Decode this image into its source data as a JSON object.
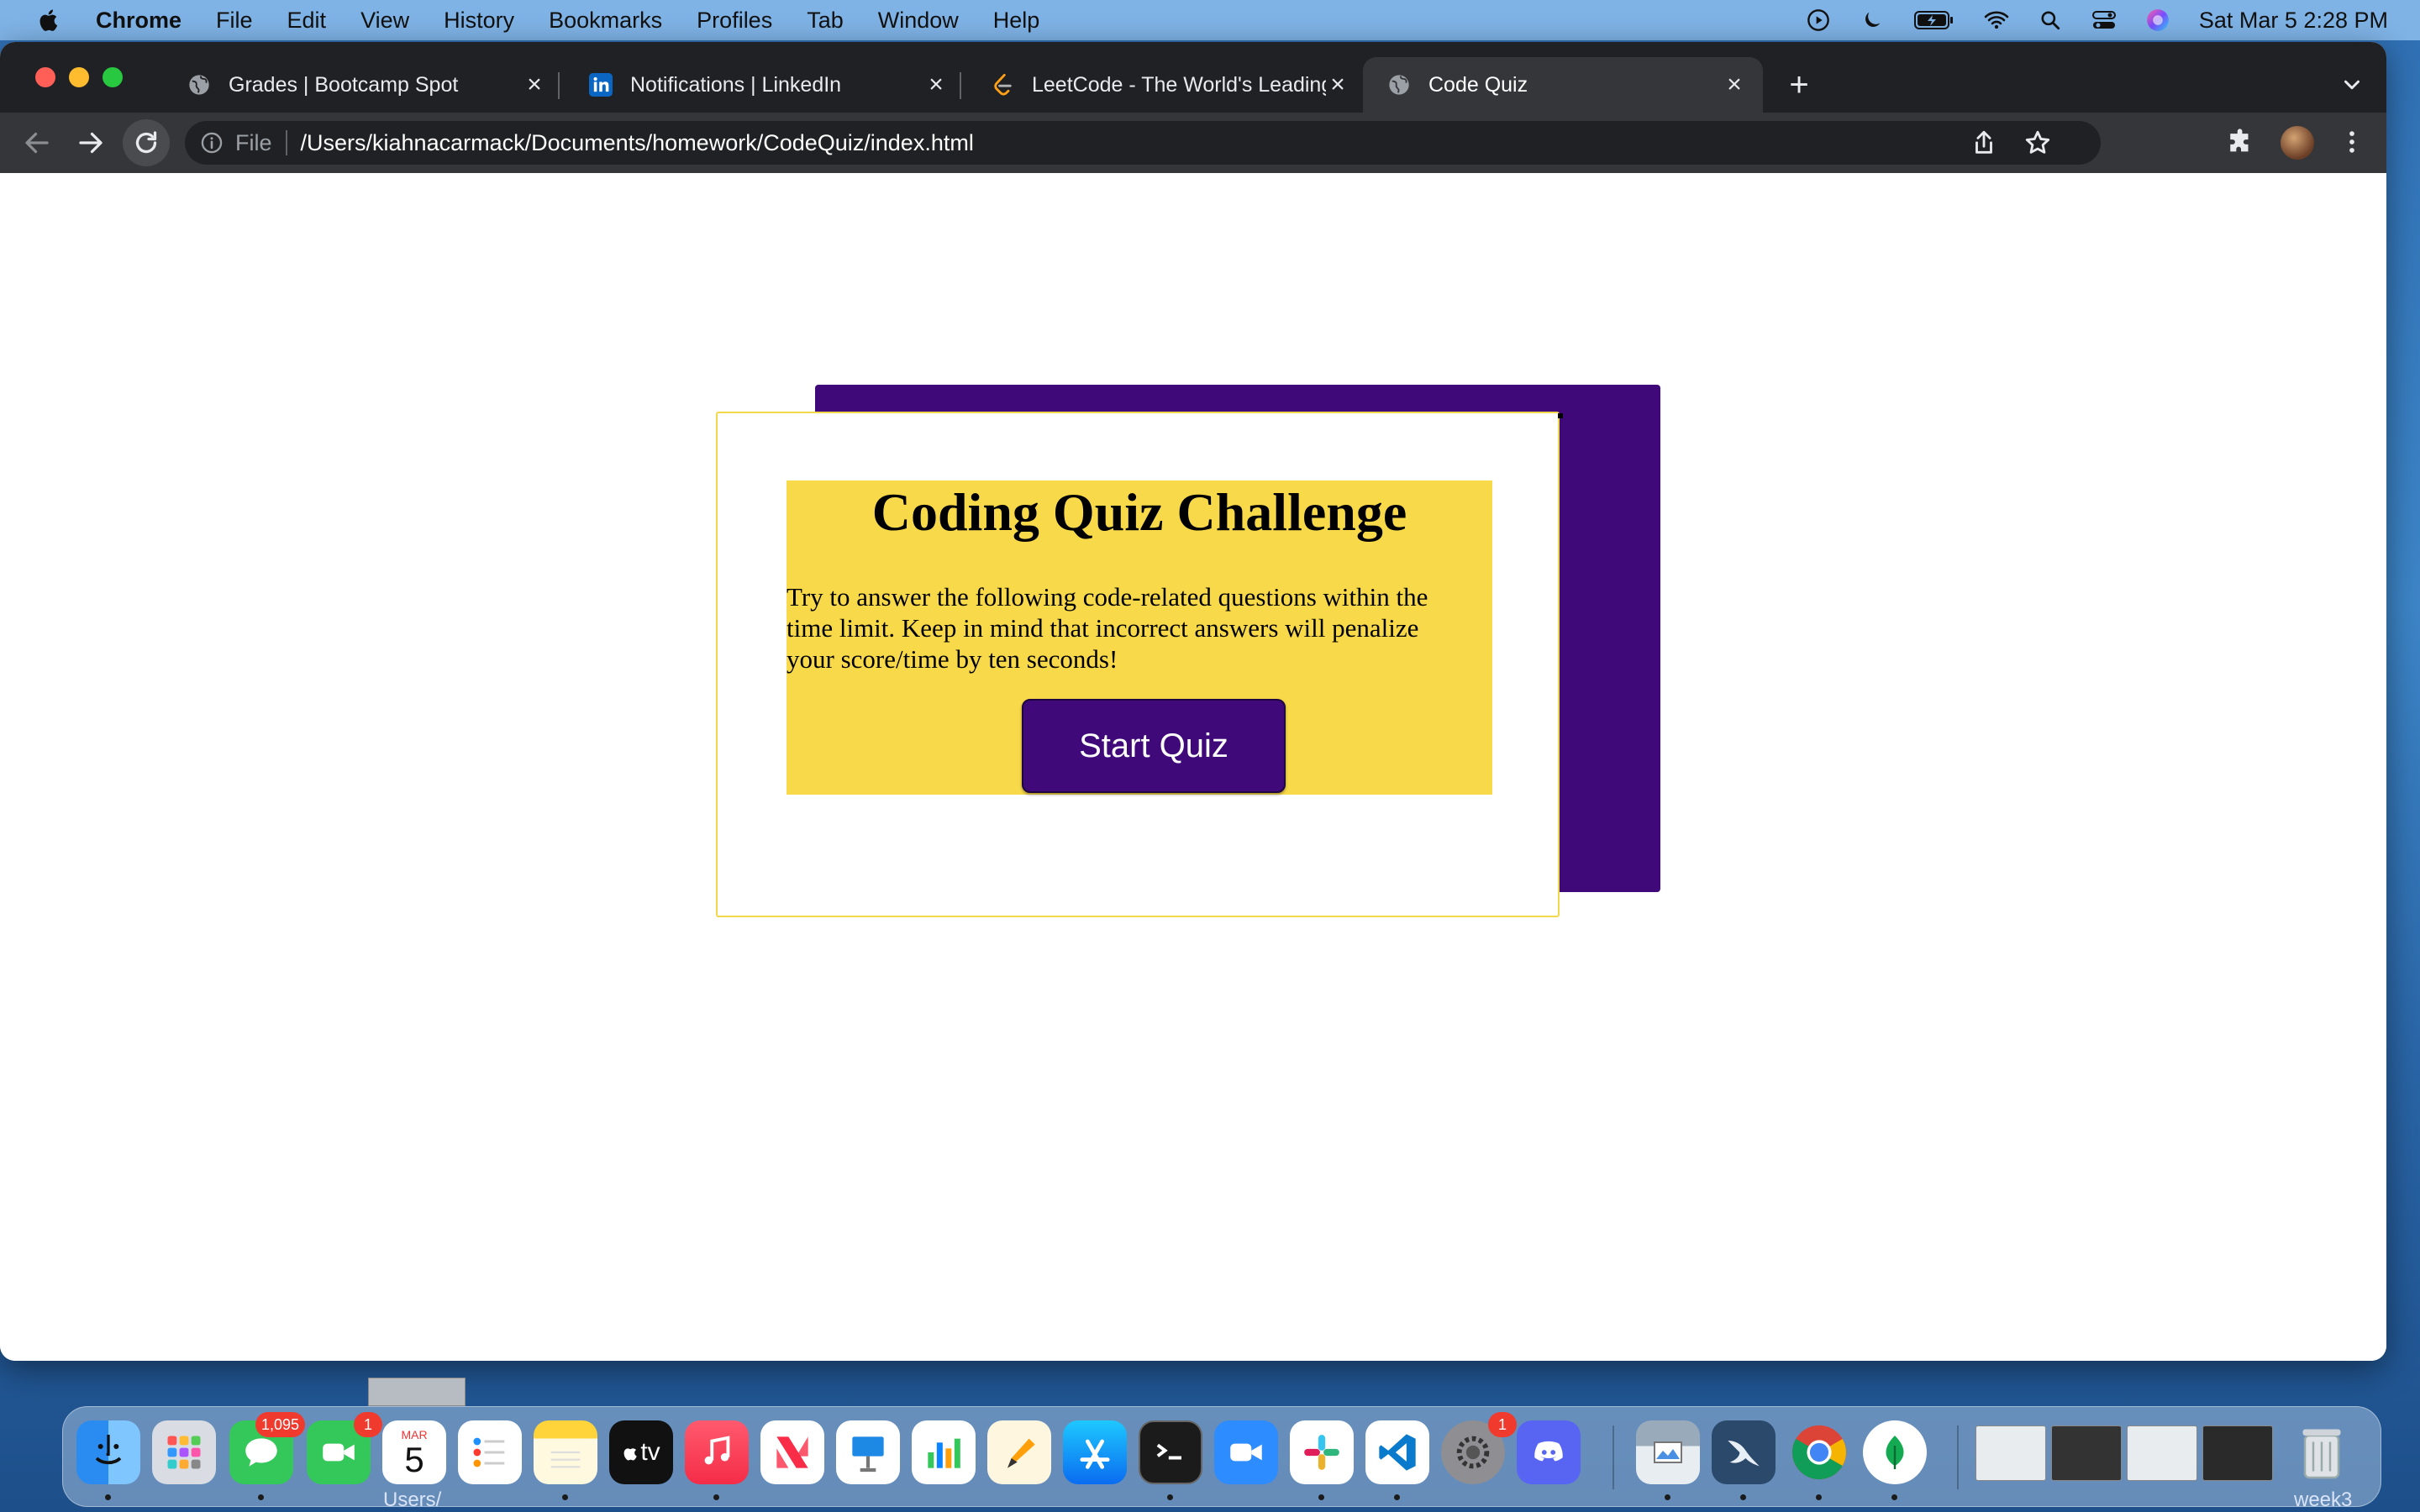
{
  "menubar": {
    "app_name": "Chrome",
    "items": [
      "File",
      "Edit",
      "View",
      "History",
      "Bookmarks",
      "Profiles",
      "Tab",
      "Window",
      "Help"
    ],
    "clock": "Sat Mar 5  2:28 PM"
  },
  "tabs": [
    {
      "title": "Grades | Bootcamp Spot",
      "icon": "globe-icon"
    },
    {
      "title": "Notifications | LinkedIn",
      "icon": "linkedin-icon"
    },
    {
      "title": "LeetCode - The World's Leading",
      "icon": "leetcode-icon"
    },
    {
      "title": "Code Quiz",
      "icon": "globe-icon"
    }
  ],
  "omnibox": {
    "scheme": "File",
    "url": "/Users/kiahnacarmack/Documents/homework/CodeQuiz/index.html"
  },
  "quiz": {
    "title": "Coding Quiz Challenge",
    "description": "Try to answer the following code-related questions within the time limit. Keep in mind that incorrect answers will penalize your score/time by ten seconds!",
    "start_label": "Start Quiz"
  },
  "dock": {
    "messages_badge": "1,095",
    "facetime_badge": "1",
    "calendar_month": "MAR",
    "calendar_day": "5",
    "appletv_label": "tv",
    "settings_badge": "1"
  },
  "desktop": {
    "folder_label": "Users/",
    "week_label": "week3"
  },
  "colors": {
    "accent_purple": "#40097a",
    "panel_yellow": "#f8d94a"
  }
}
